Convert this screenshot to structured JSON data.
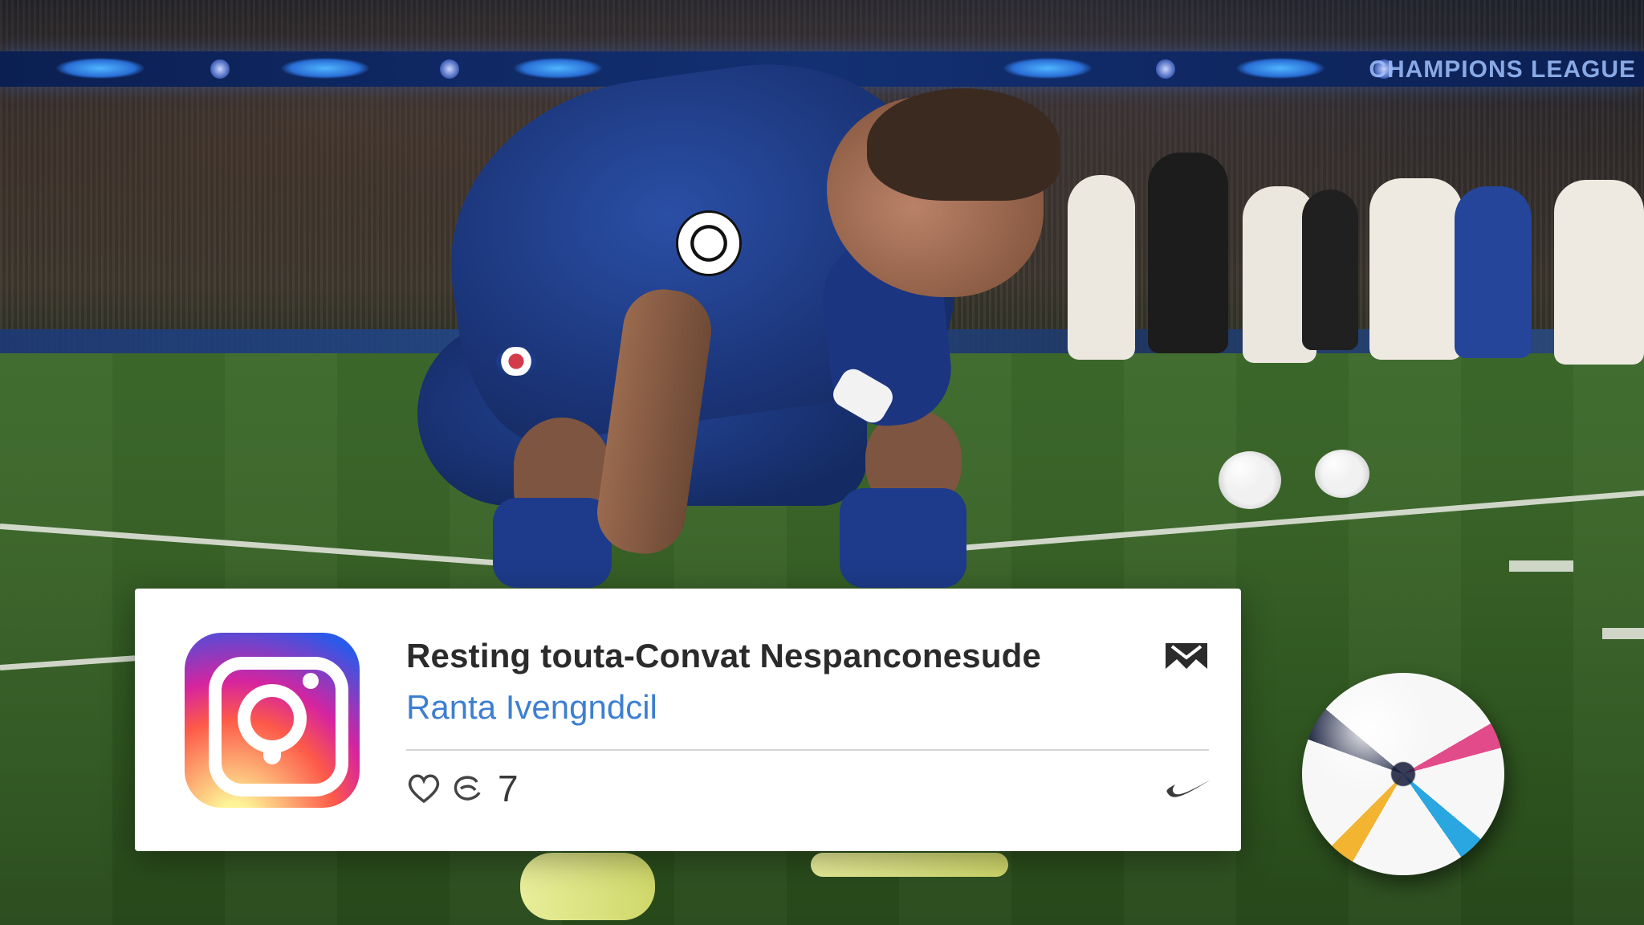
{
  "notification": {
    "app_icon": "instagram-icon",
    "title": "Resting touta-Convat Nespanconesude",
    "subtitle": "Ranta Ivengndcil",
    "count": "7",
    "icons": {
      "corner": "bookmark-icon",
      "like": "heart-icon",
      "comment": "comment-icon",
      "brand": "swoosh-icon"
    }
  },
  "scene": {
    "led_text": "CHAMPIONS LEAGUE",
    "colors": {
      "pitch": "#3a6428",
      "home_kit": "#1b3579",
      "away_kit": "#efece4",
      "accent_link": "#3d7fd1"
    }
  }
}
